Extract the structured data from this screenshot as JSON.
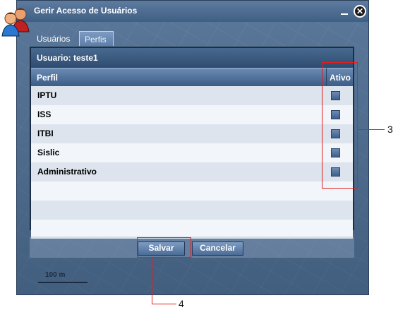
{
  "window": {
    "title": "Gerir Acesso de Usuários",
    "minimize": "minimize-icon",
    "close_icon": "close-icon",
    "close_glyph": "✕"
  },
  "tabs": [
    {
      "label": "Usuários",
      "active": false
    },
    {
      "label": "Perfis",
      "active": true
    }
  ],
  "panel": {
    "user_label": "Usuario: teste1",
    "columns": {
      "perfil": "Perfil",
      "ativo": "Ativo"
    },
    "rows": [
      {
        "label": "IPTU",
        "checked": false
      },
      {
        "label": "ISS",
        "checked": false
      },
      {
        "label": "ITBI",
        "checked": false
      },
      {
        "label": "Sislic",
        "checked": false
      },
      {
        "label": "Administrativo",
        "checked": false
      }
    ]
  },
  "buttons": {
    "save": "Salvar",
    "cancel": "Cancelar"
  },
  "map": {
    "scale_label": "100 m"
  },
  "annotations": {
    "ativo_column": "3",
    "save_button": "4"
  },
  "colors": {
    "accent": "#3f5f84",
    "annotation": "#e02020"
  }
}
